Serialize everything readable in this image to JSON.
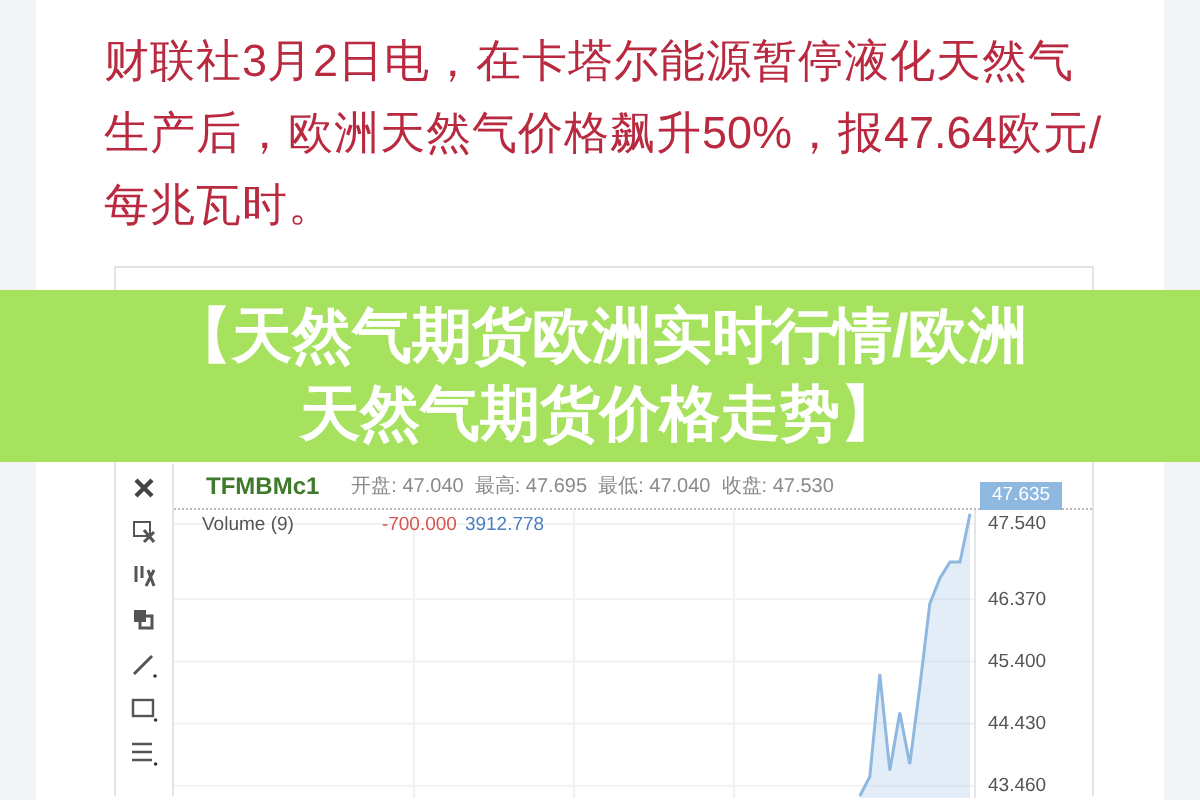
{
  "article": {
    "text": "财联社3月2日电，在卡塔尔能源暂停液化天然气生产后，欧洲天然气价格飙升50%，报47.64欧元/每兆瓦时。"
  },
  "banner_title": "【天然气期货欧洲实时行情/欧洲天然气期货价格走势】",
  "chart_panel": {
    "toolbar": [
      {
        "kind": "close"
      },
      {
        "kind": "cursor"
      },
      {
        "kind": "cursor2"
      },
      {
        "kind": "layers"
      },
      {
        "kind": "line"
      },
      {
        "kind": "rect"
      },
      {
        "kind": "hlines"
      }
    ],
    "symbol": "TFMBMc1",
    "ohlc": "开盘: 47.040  最高: 47.695  最低: 47.040  收盘: 47.530",
    "volume_legend": {
      "label": "Volume (9)",
      "low": "-700.000",
      "high": "3912.778"
    },
    "last_price": "47.635",
    "chart_data": {
      "type": "area",
      "categories": [
        null,
        null,
        null,
        null,
        null,
        null,
        null,
        null,
        null,
        null,
        null,
        null,
        null,
        null,
        null,
        null,
        null,
        null,
        null,
        null,
        null,
        null,
        null,
        null,
        null,
        null,
        null,
        null,
        null,
        null,
        null,
        null,
        null,
        null,
        null,
        null,
        null,
        null,
        null,
        null,
        null,
        null,
        null,
        null,
        null,
        null,
        null,
        null,
        null,
        null,
        null,
        null,
        null,
        null,
        null,
        null,
        null,
        null,
        null,
        null,
        null,
        null,
        null,
        null,
        null,
        null,
        null,
        null,
        null,
        null,
        null,
        null,
        null,
        null,
        null,
        null,
        null,
        null,
        null,
        null
      ],
      "ylim": [
        43.27,
        47.76
      ],
      "grid": true,
      "yticks": [
        {
          "value": 47.54,
          "label": "47.540"
        },
        {
          "value": 46.37,
          "label": "46.370"
        },
        {
          "value": 45.4,
          "label": "45.400"
        },
        {
          "value": 44.43,
          "label": "44.430"
        },
        {
          "value": 43.46,
          "label": "43.460"
        }
      ],
      "series": [
        {
          "color": "#8fb8e0",
          "values": [
            null,
            null,
            null,
            null,
            null,
            null,
            null,
            null,
            null,
            null,
            null,
            null,
            null,
            null,
            null,
            null,
            null,
            null,
            null,
            null,
            null,
            null,
            null,
            null,
            null,
            null,
            null,
            null,
            null,
            null,
            null,
            null,
            null,
            null,
            null,
            null,
            null,
            null,
            null,
            null,
            null,
            null,
            null,
            null,
            null,
            null,
            null,
            null,
            null,
            null,
            null,
            null,
            null,
            null,
            null,
            null,
            null,
            null,
            null,
            null,
            null,
            null,
            null,
            null,
            null,
            null,
            null,
            null,
            43.3,
            43.6,
            45.2,
            43.7,
            44.6,
            43.8,
            45.0,
            46.3,
            46.7,
            46.95,
            46.95,
            47.7
          ]
        }
      ]
    }
  }
}
